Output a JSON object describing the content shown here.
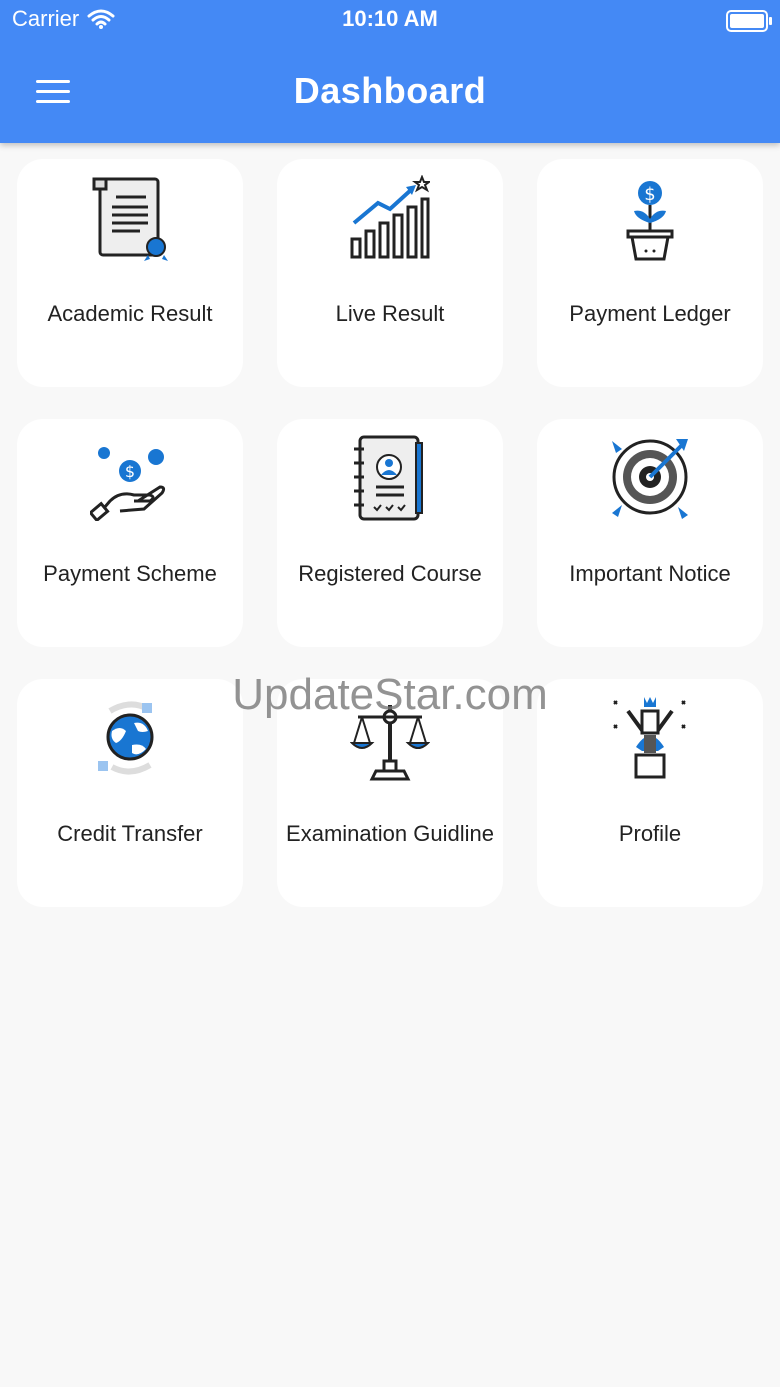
{
  "status_bar": {
    "carrier": "Carrier",
    "time": "10:10 AM"
  },
  "header": {
    "title": "Dashboard"
  },
  "menu": [
    {
      "label": "Academic Result",
      "icon": "certificate-icon"
    },
    {
      "label": "Live Result",
      "icon": "growth-chart-icon"
    },
    {
      "label": "Payment Ledger",
      "icon": "money-plant-icon"
    },
    {
      "label": "Payment Scheme",
      "icon": "hand-coins-icon"
    },
    {
      "label": "Registered Course",
      "icon": "notebook-profile-icon"
    },
    {
      "label": "Important Notice",
      "icon": "target-icon"
    },
    {
      "label": "Credit Transfer",
      "icon": "globe-transfer-icon"
    },
    {
      "label": "Examination Guidline",
      "icon": "scales-icon"
    },
    {
      "label": "Profile",
      "icon": "winner-icon"
    }
  ],
  "watermark": "UpdateStar.com",
  "colors": {
    "accent": "#4489f5",
    "icon_blue": "#1976d2"
  }
}
